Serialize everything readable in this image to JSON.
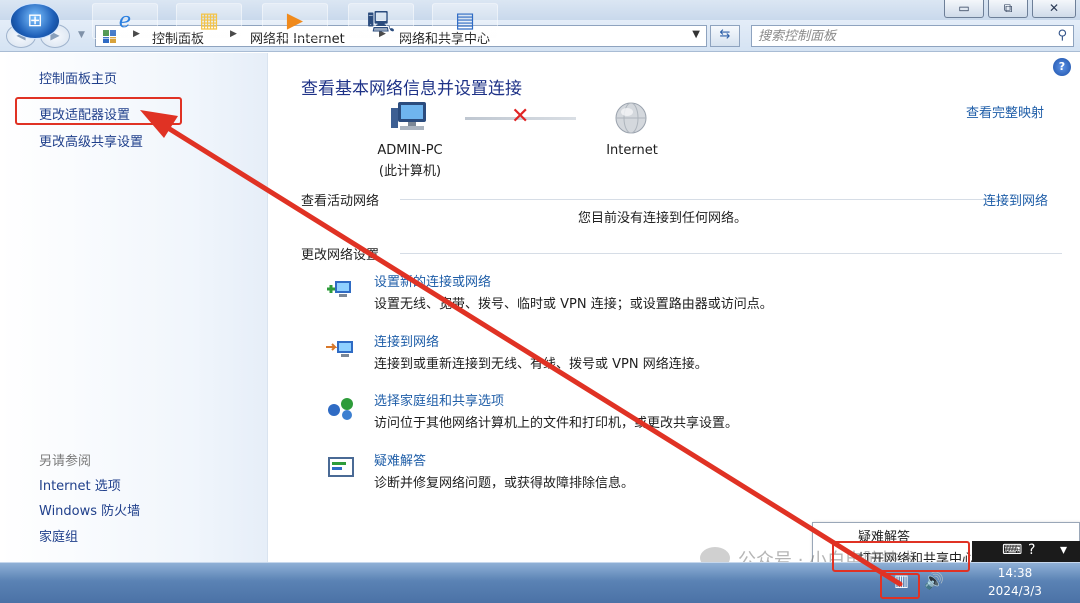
{
  "window": {
    "min_glyph": "▭",
    "max_glyph": "⧉",
    "close_glyph": "✕"
  },
  "address_bar": {
    "crumbs": [
      "控制面板",
      "网络和 Internet",
      "网络和共享中心"
    ],
    "search_placeholder": "搜索控制面板"
  },
  "sidebar": {
    "home": "控制面板主页",
    "change_adapter": "更改适配器设置",
    "change_sharing": "更改高级共享设置",
    "see_also_header": "另请参阅",
    "see_also": [
      "Internet 选项",
      "Windows 防火墙",
      "家庭组"
    ]
  },
  "main": {
    "title": "查看基本网络信息并设置连接",
    "full_map_link": "查看完整映射",
    "computer_name": "ADMIN-PC",
    "computer_sub": "(此计算机)",
    "internet_label": "Internet",
    "active_networks_header": "查看活动网络",
    "connect_link": "连接到网络",
    "no_connection": "您目前没有连接到任何网络。",
    "change_settings_header": "更改网络设置",
    "tasks": [
      {
        "link": "设置新的连接或网络",
        "desc": "设置无线、宽带、拨号、临时或 VPN 连接；或设置路由器或访问点。",
        "icon": "new-connection-icon"
      },
      {
        "link": "连接到网络",
        "desc": "连接到或重新连接到无线、有线、拨号或 VPN 网络连接。",
        "icon": "connect-network-icon"
      },
      {
        "link": "选择家庭组和共享选项",
        "desc": "访问位于其他网络计算机上的文件和打印机，或更改共享设置。",
        "icon": "homegroup-icon"
      },
      {
        "link": "疑难解答",
        "desc": "诊断并修复网络问题，或获得故障排除信息。",
        "icon": "troubleshoot-icon"
      }
    ]
  },
  "tray_menu": {
    "troubleshoot": "疑难解答",
    "open_center": "打开网络和共享中心"
  },
  "taskbar": {
    "time": "14:38",
    "date": "2024/3/3"
  },
  "watermark": "公众号 · 小白电脑技术",
  "colors": {
    "link": "#1f5ea8",
    "title": "#1e3287",
    "annotation_red": "#e03224"
  }
}
